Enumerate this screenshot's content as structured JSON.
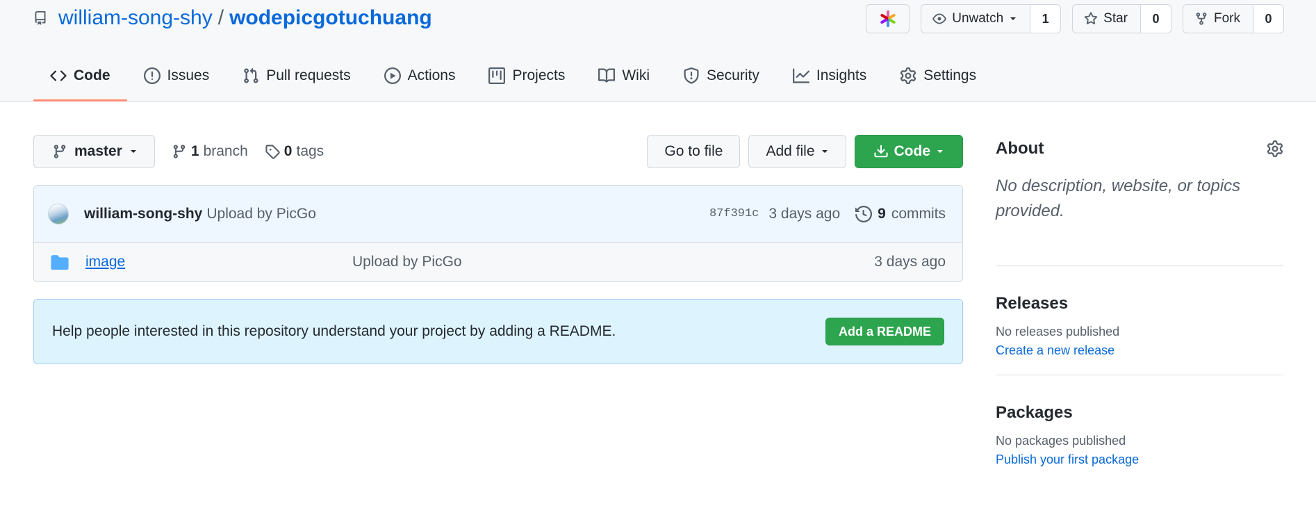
{
  "repo": {
    "owner": "william-song-shy",
    "slash": "/",
    "name": "wodepicgotuchuang"
  },
  "actions": {
    "watch": {
      "label": "Unwatch",
      "count": "1"
    },
    "star": {
      "label": "Star",
      "count": "0"
    },
    "fork": {
      "label": "Fork",
      "count": "0"
    }
  },
  "nav": {
    "code": "Code",
    "issues": "Issues",
    "pulls": "Pull requests",
    "actions": "Actions",
    "projects": "Projects",
    "wiki": "Wiki",
    "security": "Security",
    "insights": "Insights",
    "settings": "Settings"
  },
  "toolbar": {
    "branch": "master",
    "branch_count": "1",
    "branch_label": "branch",
    "tag_count": "0",
    "tag_label": "tags",
    "go_to_file": "Go to file",
    "add_file": "Add file",
    "code": "Code"
  },
  "commit": {
    "author": "william-song-shy",
    "message": "Upload by PicGo",
    "sha": "87f391c",
    "time": "3 days ago",
    "count": "9",
    "count_label": "commits"
  },
  "files": [
    {
      "name": "image",
      "message": "Upload by PicGo",
      "time": "3 days ago"
    }
  ],
  "readme_flash": {
    "text": "Help people interested in this repository understand your project by adding a README.",
    "button": "Add a README"
  },
  "sidebar": {
    "about_title": "About",
    "about_text": "No description, website, or topics provided.",
    "releases_title": "Releases",
    "releases_text": "No releases published",
    "releases_link": "Create a new release",
    "packages_title": "Packages",
    "packages_text": "No packages published",
    "packages_link": "Publish your first package"
  },
  "colors": {
    "link": "#0969da",
    "green_button": "#2da44e",
    "selected_tab_underline": "#fd8c73",
    "readme_flash_bg": "#ddf4ff"
  }
}
